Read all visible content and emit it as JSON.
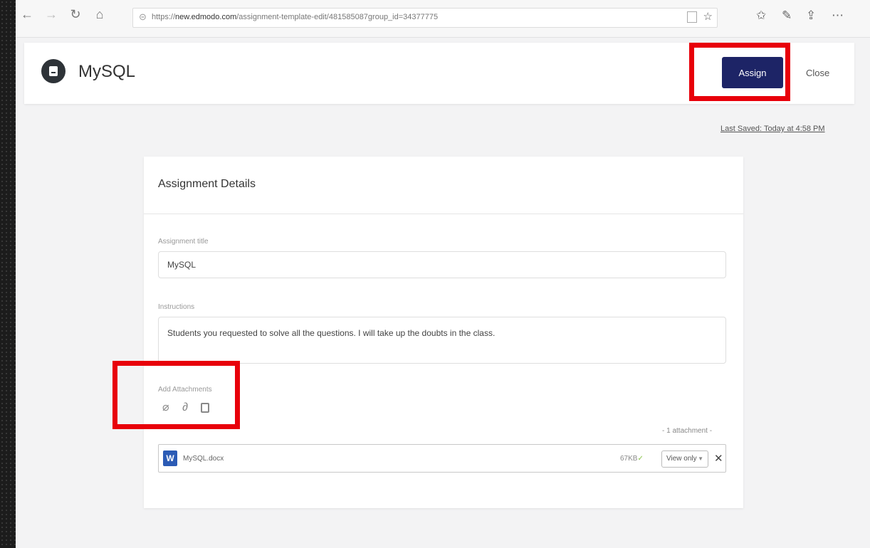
{
  "browser": {
    "url_prefix": "https://",
    "url_host": "new.edmodo.com",
    "url_path": "/assignment-template-edit/481585087group_id=34377775",
    "icons": [
      "back-icon",
      "forward-icon",
      "refresh-icon",
      "home-icon",
      "lock-icon",
      "reader-icon",
      "favorite-icon",
      "favorites-icon",
      "pen-icon",
      "share-icon",
      "more-icon"
    ]
  },
  "header": {
    "title": "MySQL",
    "assign_label": "Assign",
    "close_label": "Close",
    "last_saved": "Last Saved: Today at 4:58 PM"
  },
  "card": {
    "title": "Assignment Details",
    "title_label": "Assignment title",
    "title_value": "MySQL",
    "instructions_label": "Instructions",
    "instructions_value": "Students you requested to solve all the questions. I will take up the doubts in the class.",
    "attachments_label": "Add Attachments",
    "attachments_count": "- 1 attachment -",
    "attachment": {
      "icon_letter": "W",
      "name": "MySQL.docx",
      "size": "67KB",
      "permission": "View only"
    }
  },
  "colors": {
    "assign_button": "#1d2466",
    "highlight": "#e8000a",
    "word_icon": "#2b5bb5"
  }
}
